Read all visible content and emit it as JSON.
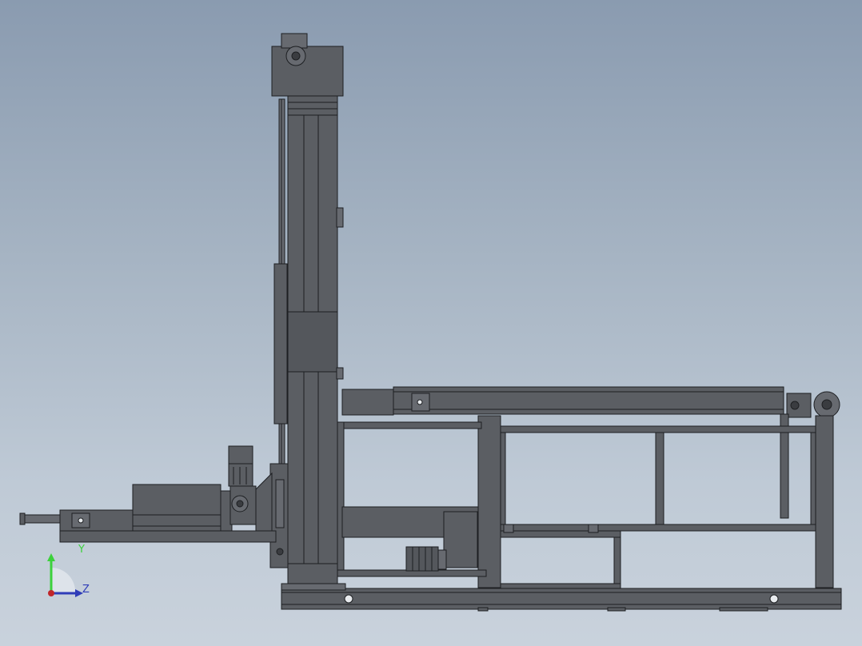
{
  "viewport": {
    "background_top": "#8a9bb0",
    "background_bottom": "#c9d2dc",
    "part_fill": "#5b5e63",
    "part_fill_light": "#676a70",
    "edge_color": "#1d1f22"
  },
  "triad": {
    "y_label": "Y",
    "z_label": "Z",
    "y_color": "#3cd13c",
    "z_color": "#2f3db8",
    "origin_color": "#c0262a"
  }
}
